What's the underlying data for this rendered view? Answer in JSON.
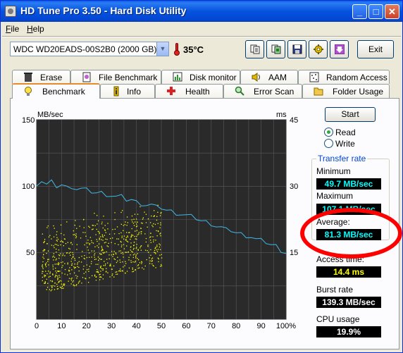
{
  "window": {
    "title": "HD Tune Pro 3.50 - Hard Disk Utility",
    "buttons": {
      "minimize": "_",
      "maximize": "□",
      "close": "✕"
    }
  },
  "menu": {
    "file_u": "F",
    "file_rest": "ile",
    "help_u": "H",
    "help_rest": "elp"
  },
  "toolbar": {
    "drive": "WDC WD20EADS-00S2B0 (2000 GB)",
    "temperature": "35°C",
    "exit_label": "Exit",
    "icons": [
      "copy-info-icon",
      "copy-screenshot-icon",
      "save-icon",
      "options-icon",
      "download-icon"
    ]
  },
  "tabs": {
    "row1": [
      "Erase",
      "File Benchmark",
      "Disk monitor",
      "AAM",
      "Random Access"
    ],
    "row2": [
      "Benchmark",
      "Info",
      "Health",
      "Error Scan",
      "Folder Usage"
    ],
    "active": "Benchmark"
  },
  "controls": {
    "start_label": "Start",
    "read_label": "Read",
    "write_label": "Write",
    "selected": "Read"
  },
  "transfer_rate": {
    "title": "Transfer rate",
    "minimum_label": "Minimum",
    "minimum_value": "49.7 MB/sec",
    "maximum_label": "Maximum",
    "maximum_value": "107.1 MB/sec",
    "average_label": "Average:",
    "average_value": "81.3 MB/sec"
  },
  "access": {
    "access_time_label": "Access time:",
    "access_time_value": "14.4 ms",
    "burst_rate_label": "Burst rate",
    "burst_rate_value": "139.3 MB/sec",
    "cpu_usage_label": "CPU usage",
    "cpu_usage_value": "19.9%"
  },
  "colors": {
    "transfer_line": "#3fb8e8",
    "access_points": "#ffff00",
    "chart_bg": "#2a2a2a",
    "highlight": "#ff0000"
  },
  "chart_data": {
    "type": "line",
    "ylabel_left": "MB/sec",
    "ylabel_right": "ms",
    "ylim_left": [
      0,
      150
    ],
    "ylim_right": [
      0,
      45
    ],
    "left_ticks": [
      "150",
      "100",
      "50"
    ],
    "right_ticks": [
      "45",
      "30",
      "15"
    ],
    "x_ticks": [
      "0",
      "10",
      "20",
      "30",
      "40",
      "50",
      "60",
      "70",
      "80",
      "90",
      "100%"
    ],
    "grid": true,
    "series": [
      {
        "axis": "left",
        "x": [
          0,
          2,
          4,
          6,
          8,
          10,
          12,
          14,
          16,
          18,
          20,
          22,
          24,
          26,
          28,
          30,
          32,
          34,
          36,
          38,
          40,
          42,
          44,
          46,
          48,
          50,
          52,
          54,
          56,
          58,
          60,
          62,
          64,
          66,
          68,
          70,
          72,
          74,
          76,
          78,
          80,
          82,
          84,
          86,
          88,
          90,
          92,
          94,
          96,
          98,
          100
        ],
        "values": [
          102,
          104,
          101,
          103,
          100,
          101,
          99,
          100,
          98,
          98,
          97,
          96,
          95,
          95,
          94,
          93,
          92,
          92,
          90,
          90,
          88,
          87,
          86,
          86,
          84,
          84,
          82,
          81,
          80,
          79,
          78,
          77,
          76,
          74,
          73,
          72,
          70,
          69,
          67,
          67,
          65,
          64,
          63,
          62,
          60,
          59,
          58,
          56,
          55,
          52,
          50
        ]
      },
      {
        "axis": "right",
        "type": "scatter",
        "x_range": [
          2,
          50
        ],
        "y_range_ms": [
          6,
          28
        ]
      }
    ]
  }
}
